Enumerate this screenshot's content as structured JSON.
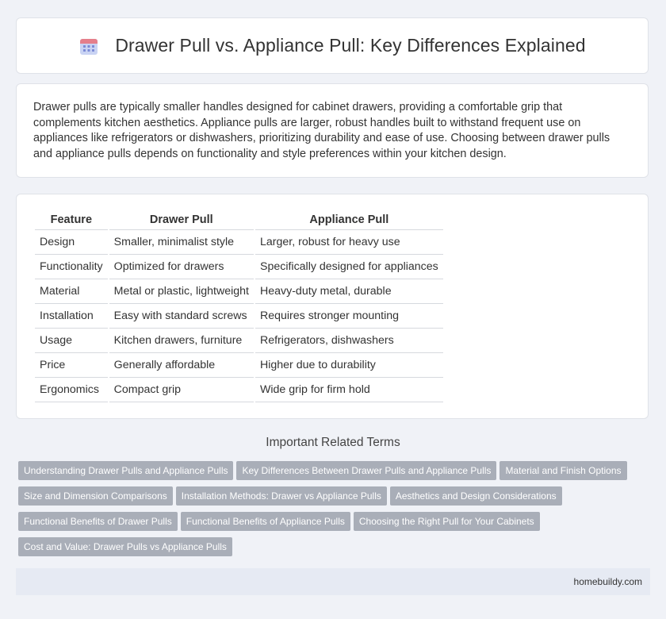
{
  "header": {
    "title": "Drawer Pull vs. Appliance Pull: Key Differences Explained",
    "icon": "calendar-icon"
  },
  "intro": {
    "text": "Drawer pulls are typically smaller handles designed for cabinet drawers, providing a comfortable grip that complements kitchen aesthetics. Appliance pulls are larger, robust handles built to withstand frequent use on appliances like refrigerators or dishwashers, prioritizing durability and ease of use. Choosing between drawer pulls and appliance pulls depends on functionality and style preferences within your kitchen design."
  },
  "table": {
    "headers": [
      "Feature",
      "Drawer Pull",
      "Appliance Pull"
    ],
    "rows": [
      [
        "Design",
        "Smaller, minimalist style",
        "Larger, robust for heavy use"
      ],
      [
        "Functionality",
        "Optimized for drawers",
        "Specifically designed for appliances"
      ],
      [
        "Material",
        "Metal or plastic, lightweight",
        "Heavy-duty metal, durable"
      ],
      [
        "Installation",
        "Easy with standard screws",
        "Requires stronger mounting"
      ],
      [
        "Usage",
        "Kitchen drawers, furniture",
        "Refrigerators, dishwashers"
      ],
      [
        "Price",
        "Generally affordable",
        "Higher due to durability"
      ],
      [
        "Ergonomics",
        "Compact grip",
        "Wide grip for firm hold"
      ]
    ]
  },
  "related": {
    "title": "Important Related Terms",
    "terms": [
      "Understanding Drawer Pulls and Appliance Pulls",
      "Key Differences Between Drawer Pulls and Appliance Pulls",
      "Material and Finish Options",
      "Size and Dimension Comparisons",
      "Installation Methods: Drawer vs Appliance Pulls",
      "Aesthetics and Design Considerations",
      "Functional Benefits of Drawer Pulls",
      "Functional Benefits of Appliance Pulls",
      "Choosing the Right Pull for Your Cabinets",
      "Cost and Value: Drawer Pulls vs Appliance Pulls"
    ]
  },
  "footer": {
    "site": "homebuildy.com"
  }
}
